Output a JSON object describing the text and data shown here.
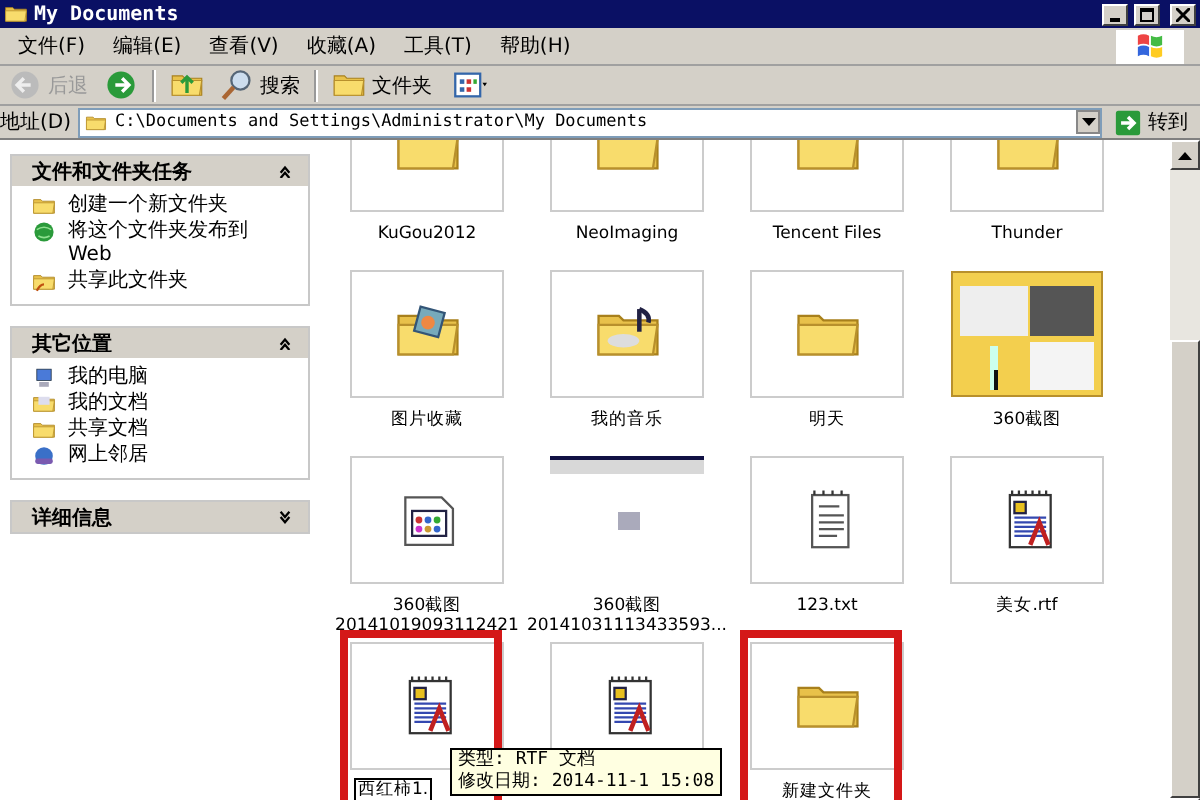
{
  "window": {
    "title": "My Documents"
  },
  "menu": [
    {
      "label": "文件(F)"
    },
    {
      "label": "编辑(E)"
    },
    {
      "label": "查看(V)"
    },
    {
      "label": "收藏(A)"
    },
    {
      "label": "工具(T)"
    },
    {
      "label": "帮助(H)"
    }
  ],
  "toolbar": [
    {
      "kind": "back",
      "label": "后退",
      "disabled": true
    },
    {
      "kind": "forward",
      "disabled": false
    },
    {
      "kind": "up",
      "disabled": false
    },
    {
      "kind": "search",
      "label": "搜索",
      "disabled": false
    },
    {
      "kind": "folders",
      "label": "文件夹",
      "disabled": false
    },
    {
      "kind": "views",
      "disabled": false
    }
  ],
  "address": {
    "label": "地址(D)",
    "value": "C:\\Documents and Settings\\Administrator\\My Documents",
    "go": "转到"
  },
  "sidebar": {
    "panels": [
      {
        "title": "文件和文件夹任务",
        "expanded": true,
        "items": [
          {
            "kind": "new-folder",
            "label": "创建一个新文件夹"
          },
          {
            "kind": "globe",
            "label": "将这个文件夹发布到 Web"
          },
          {
            "kind": "share",
            "label": "共享此文件夹"
          }
        ]
      },
      {
        "title": "其它位置",
        "expanded": true,
        "items": [
          {
            "kind": "computer",
            "label": "我的电脑"
          },
          {
            "kind": "documents",
            "label": "我的文档"
          },
          {
            "kind": "folder",
            "label": "共享文档"
          },
          {
            "kind": "network",
            "label": "网上邻居"
          }
        ]
      },
      {
        "title": "详细信息",
        "expanded": false
      }
    ]
  },
  "files": [
    {
      "kind": "folder",
      "name": "KuGou2012",
      "highlighted": false,
      "renaming": false
    },
    {
      "kind": "folder",
      "name": "NeoImaging",
      "highlighted": false,
      "renaming": false
    },
    {
      "kind": "folder",
      "name": "Tencent Files",
      "highlighted": false,
      "renaming": false
    },
    {
      "kind": "folder",
      "name": "Thunder",
      "highlighted": false,
      "renaming": false
    },
    {
      "kind": "pictures-folder",
      "name": "图片收藏",
      "highlighted": false,
      "renaming": false
    },
    {
      "kind": "music-folder",
      "name": "我的音乐",
      "highlighted": false,
      "renaming": false
    },
    {
      "kind": "folder",
      "name": "明天",
      "highlighted": false,
      "renaming": false
    },
    {
      "kind": "screenshot-folder",
      "name": "360截图",
      "highlighted": false,
      "renaming": false
    },
    {
      "kind": "image-file",
      "name": "360截图 20141019093112421",
      "highlighted": false,
      "renaming": false
    },
    {
      "kind": "screenshot-file",
      "name": "360截图 20141031113433593...",
      "highlighted": false,
      "renaming": false
    },
    {
      "kind": "txt",
      "name": "123.txt",
      "highlighted": false,
      "renaming": false
    },
    {
      "kind": "rtf",
      "name": "美女.rtf",
      "highlighted": false,
      "renaming": false
    },
    {
      "kind": "rtf",
      "name": "西红柿1.",
      "highlighted": true,
      "renaming": true
    },
    {
      "kind": "rtf",
      "highlighted": false,
      "renaming": false
    },
    {
      "kind": "folder",
      "name": "新建文件夹",
      "highlighted": true,
      "renaming": false
    }
  ],
  "tooltip": {
    "lines": [
      "类型: RTF 文档",
      "修改日期: 2014-11-1 15:08"
    ]
  }
}
